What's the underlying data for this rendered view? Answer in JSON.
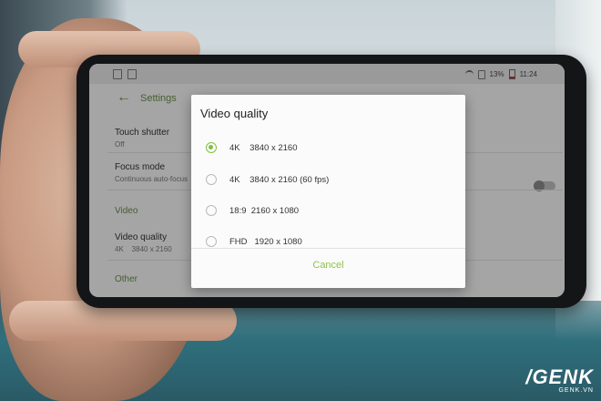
{
  "status_bar": {
    "battery": "13%",
    "time": "11:24"
  },
  "app_bar": {
    "title": "Settings"
  },
  "settings": {
    "touch_shutter": {
      "title": "Touch shutter",
      "value": "Off"
    },
    "focus_mode": {
      "title": "Focus mode",
      "value": "Continuous auto-focus"
    },
    "section_video": "Video",
    "video_quality": {
      "title": "Video quality",
      "value": "4K    3840 x 2160"
    },
    "section_other": "Other"
  },
  "dialog": {
    "title": "Video quality",
    "options": [
      {
        "label": "4K    3840 x 2160",
        "selected": true
      },
      {
        "label": "4K    3840 x 2160 (60 fps)",
        "selected": false
      },
      {
        "label": "18:9  2160 x 1080",
        "selected": false
      },
      {
        "label": "FHD   1920 x 1080",
        "selected": false
      }
    ],
    "cancel_label": "Cancel"
  },
  "watermark": {
    "brand": "GENK",
    "site": "GENK.VN"
  },
  "colors": {
    "accent_green": "#7fc241",
    "settings_green": "#6b8a49"
  }
}
